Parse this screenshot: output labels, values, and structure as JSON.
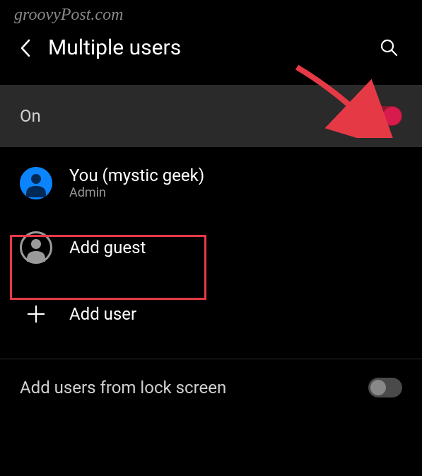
{
  "watermark": "groovyPost.com",
  "header": {
    "title": "Multiple users"
  },
  "main_toggle": {
    "label": "On",
    "state": true
  },
  "users": [
    {
      "name": "You (mystic geek)",
      "role": "Admin",
      "avatar_color": "blue"
    }
  ],
  "actions": {
    "add_guest": "Add guest",
    "add_user": "Add user"
  },
  "lock_screen": {
    "label": "Add users from lock screen",
    "state": false
  },
  "annotations": {
    "highlight_target": "add-guest",
    "arrow_target": "main-toggle"
  }
}
